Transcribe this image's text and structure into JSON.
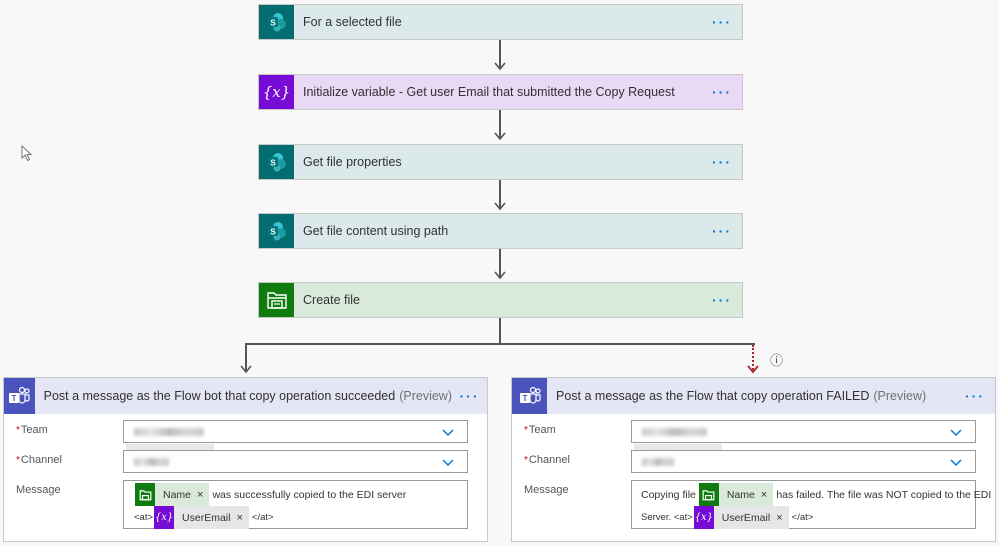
{
  "steps": [
    {
      "id": "for-selected-file",
      "title": "For a selected file",
      "icon": "sharepoint-icon",
      "more": "···"
    },
    {
      "id": "initialize-variable",
      "title": "Initialize variable - Get user Email that submitted the Copy Request",
      "icon": "variable-icon",
      "more": "···"
    },
    {
      "id": "get-file-properties",
      "title": "Get file properties",
      "icon": "sharepoint-icon",
      "more": "···"
    },
    {
      "id": "get-file-content",
      "title": "Get file content using path",
      "icon": "sharepoint-icon",
      "more": "···"
    },
    {
      "id": "create-file",
      "title": "Create file",
      "icon": "file-system-icon",
      "more": "···"
    }
  ],
  "branches": {
    "success": {
      "title": "Post a message as the Flow bot that copy operation succeeded",
      "preview": "(Preview)",
      "more": "···",
      "team_label": "Team",
      "channel_label": "Channel",
      "message_label": "Message",
      "required_mark": "*",
      "message": {
        "line1_prefix": "",
        "token1": "Name",
        "line1_suffix": "was successfully copied to the EDI server",
        "line2_prefix": "<at>",
        "token2": "UserEmail",
        "line2_suffix": "</at>",
        "remove": "×"
      }
    },
    "failure": {
      "title": "Post a message as the Flow that copy operation FAILED",
      "preview": "(Preview)",
      "more": "···",
      "team_label": "Team",
      "channel_label": "Channel",
      "message_label": "Message",
      "required_mark": "*",
      "message": {
        "line1_prefix": "Copying file",
        "token1": "Name",
        "line1_suffix": "has failed. The file was NOT copied to the EDI",
        "line2_prefix": "Server. <at>",
        "token2": "UserEmail",
        "line2_suffix": "</at>",
        "remove": "×"
      },
      "run_after_info_icon": "ⓘ"
    }
  },
  "colors": {
    "sharepoint": "#036c70",
    "variable": "#770bd6",
    "file_system": "#107c10",
    "teams": "#4b53bc",
    "failure_connector": "#a4262c",
    "accent": "#0078d4"
  }
}
